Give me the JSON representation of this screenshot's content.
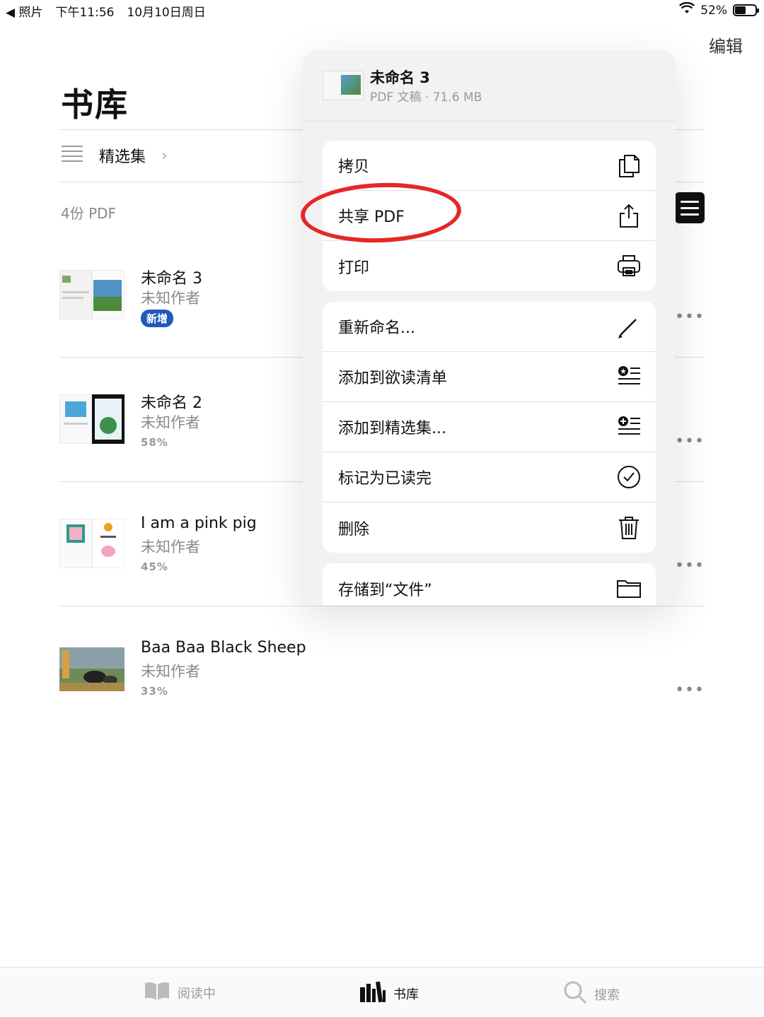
{
  "status_bar": {
    "back_app": "◀ 照片",
    "time": "下午11:56",
    "date": "10月10日周日",
    "battery": "52%",
    "battery_level": 0.52
  },
  "header": {
    "edit_label": "编辑",
    "title": "书库"
  },
  "collections": {
    "label": "精选集",
    "chevron": "›"
  },
  "count_label": "4份 PDF",
  "books": [
    {
      "title": "未命名 3",
      "author": "未知作者",
      "badge": "新增",
      "progress": ""
    },
    {
      "title": "未命名 2",
      "author": "未知作者",
      "badge": "",
      "progress": "58%"
    },
    {
      "title": "I am a pink pig",
      "author": "未知作者",
      "badge": "",
      "progress": "45%"
    },
    {
      "title": "Baa Baa Black Sheep",
      "author": "未知作者",
      "badge": "",
      "progress": "33%"
    }
  ],
  "more_label": "•••",
  "popover": {
    "doc_title": "未命名 3",
    "doc_meta": "PDF 文稿 · 71.6 MB",
    "group1": [
      {
        "label": "拷贝",
        "icon": "copy-icon"
      },
      {
        "label": "共享 PDF",
        "icon": "share-icon"
      },
      {
        "label": "打印",
        "icon": "print-icon"
      }
    ],
    "group2": [
      {
        "label": "重新命名...",
        "icon": "pencil-icon"
      },
      {
        "label": "添加到欲读清单",
        "icon": "want-to-read-icon"
      },
      {
        "label": "添加到精选集...",
        "icon": "add-collection-icon"
      },
      {
        "label": "标记为已读完",
        "icon": "checkmark-circle-icon"
      },
      {
        "label": "删除",
        "icon": "trash-icon"
      }
    ],
    "group3": [
      {
        "label": "存储到“文件”",
        "icon": "folder-icon"
      }
    ]
  },
  "tabs": [
    {
      "label": "阅读中",
      "icon": "book-open-icon"
    },
    {
      "label": "书库",
      "icon": "library-icon"
    },
    {
      "label": "搜索",
      "icon": "search-icon"
    }
  ],
  "colors": {
    "highlight": "#e52826",
    "badge": "#1e5bb8"
  }
}
